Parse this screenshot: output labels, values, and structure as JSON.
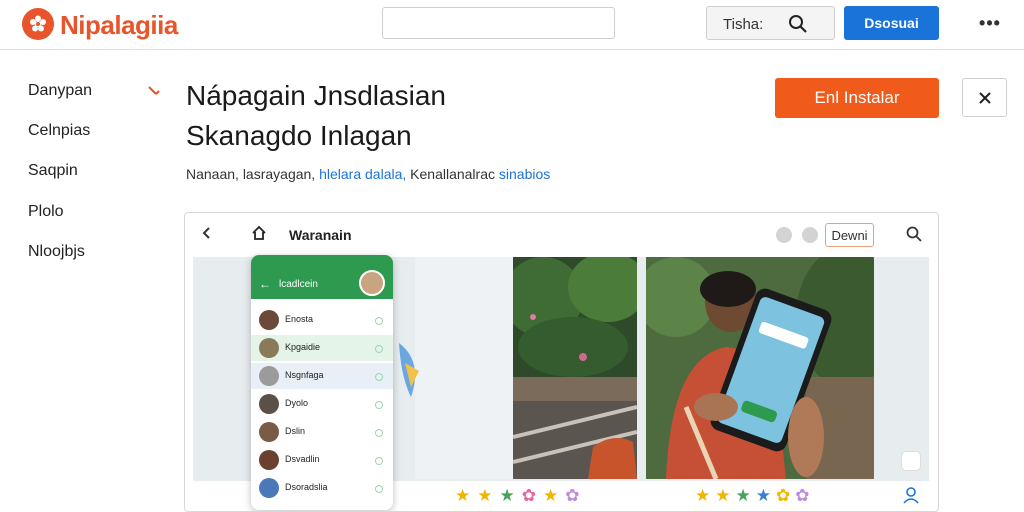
{
  "header": {
    "brand": "Nipalagiia",
    "search_placeholder": "",
    "search_label": "Tisha:",
    "primary_button": "Dsosuai",
    "more": "•••"
  },
  "sidebar": {
    "items": [
      {
        "label": "Danypan"
      },
      {
        "label": "Celnpias"
      },
      {
        "label": "Saqpin"
      },
      {
        "label": "Plolo"
      },
      {
        "label": "Nloojbjs"
      }
    ]
  },
  "app": {
    "title_line1": "Nápagain Jnsdlasian",
    "title_line2": "Skanagdo Inlagan",
    "install_label": "Enl Instalar",
    "meta_prefix": "Nanaan, lasrayagan,",
    "meta_link": "hlelara  dalala,",
    "meta_middle": "Kenallanalrac",
    "meta_link2": "sinabios"
  },
  "preview": {
    "toolbar_title": "Waranain",
    "toolbar_button": "Dewni",
    "phone_header": "lcadlcein",
    "contacts": [
      {
        "name": "Enosta",
        "color": "#6b4a3a"
      },
      {
        "name": "Kpgaidie",
        "color": "#8a7a5a"
      },
      {
        "name": "Nsgnfaga",
        "color": "#9b9b9b"
      },
      {
        "name": "Dyolo",
        "color": "#5a5048"
      },
      {
        "name": "Dslin",
        "color": "#7a5b46"
      },
      {
        "name": "Dsvadlin",
        "color": "#6a4030"
      },
      {
        "name": "Dsoradslia",
        "color": "#4a78b8"
      }
    ],
    "stars_left": [
      "★",
      "★",
      "★",
      "✿",
      "★",
      "✿"
    ],
    "stars_right": [
      "★",
      "★",
      "★",
      "★",
      "✿",
      "✿"
    ]
  },
  "colors": {
    "brand": "#e8542b",
    "primary": "#1a73d8",
    "install": "#f05a1a",
    "phone_green": "#2e9a4f"
  }
}
